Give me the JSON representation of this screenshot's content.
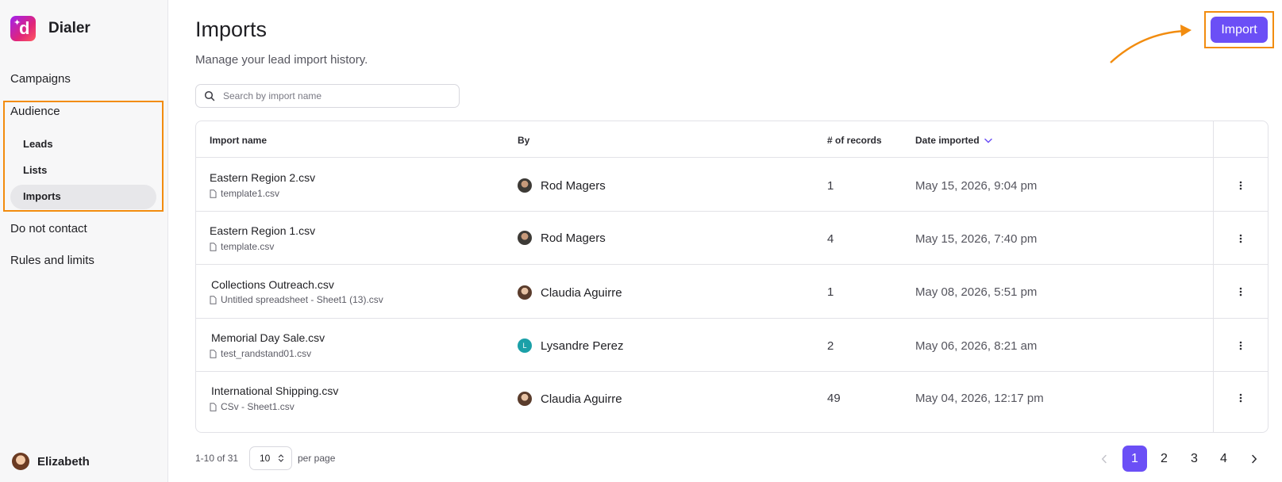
{
  "app": {
    "name": "Dialer"
  },
  "sidebar": {
    "items": [
      {
        "label": "Campaigns"
      },
      {
        "label": "Audience"
      },
      {
        "label": "Do not contact"
      },
      {
        "label": "Rules and limits"
      }
    ],
    "audience_sub": [
      {
        "label": "Leads"
      },
      {
        "label": "Lists"
      },
      {
        "label": "Imports",
        "active": true
      }
    ],
    "user": {
      "name": "Elizabeth"
    }
  },
  "page": {
    "title": "Imports",
    "subtitle": "Manage your lead import history.",
    "import_button": "Import"
  },
  "search": {
    "placeholder": "Search by import name",
    "value": ""
  },
  "table": {
    "columns": [
      "Import name",
      "By",
      "# of records",
      "Date imported"
    ],
    "sort_column": "Date imported",
    "rows": [
      {
        "name": "Eastern Region 2.csv",
        "file": "template1.csv",
        "by": "Rod Magers",
        "avatar": "photo-avatar",
        "records": "1",
        "date": "May 15, 2026, 9:04 pm"
      },
      {
        "name": "Eastern Region 1.csv",
        "file": "template.csv",
        "by": "Rod Magers",
        "avatar": "photo-avatar",
        "records": "4",
        "date": "May 15, 2026, 7:40 pm"
      },
      {
        "name": "Collections Outreach.csv",
        "file": "Untitled spreadsheet - Sheet1 (13).csv",
        "by": "Claudia Aguirre",
        "avatar": "photo-avatar",
        "records": "1",
        "date": "May 08, 2026, 5:51 pm"
      },
      {
        "name": "Memorial Day Sale.csv",
        "file": "test_randstand01.csv",
        "by": "Lysandre Perez",
        "avatar": "L",
        "records": "2",
        "date": "May 06, 2026, 8:21 am"
      },
      {
        "name": "International Shipping.csv",
        "file": "CSv - Sheet1.csv",
        "by": "Claudia Aguirre",
        "avatar": "photo-avatar",
        "records": "49",
        "date": "May 04, 2026, 12:17 pm"
      }
    ]
  },
  "pagination": {
    "range": "1-10 of 31",
    "per_page_value": "10",
    "per_page_label": "per page",
    "pages": [
      "1",
      "2",
      "3",
      "4"
    ],
    "current_page": "1"
  },
  "colors": {
    "accent": "#6b4ff6",
    "highlight": "#f28c0f",
    "lysandre_avatar": "#1ba0a8"
  }
}
